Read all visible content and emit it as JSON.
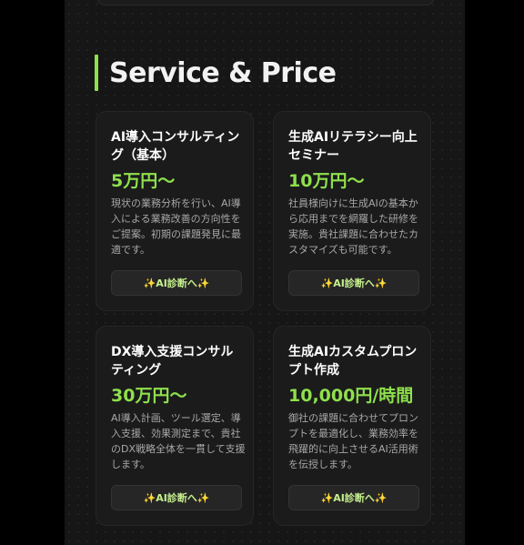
{
  "section": {
    "title": "Service & Price"
  },
  "cards": [
    {
      "title": "AI導入コンサルティング（基本）",
      "price": "5万円〜",
      "description": "現状の業務分析を行い、AI導入による業務改善の方向性をご提案。初期の課題発見に最適です。",
      "button": "✨AI診断へ✨"
    },
    {
      "title": "生成AIリテラシー向上セミナー",
      "price": "10万円〜",
      "description": "社員様向けに生成AIの基本から応用までを網羅した研修を実施。貴社課題に合わせたカスタマイズも可能です。",
      "button": "✨AI診断へ✨"
    },
    {
      "title": "DX導入支援コンサルティング",
      "price": "30万円〜",
      "description": "AI導入計画、ツール選定、導入支援、効果測定まで、貴社のDX戦略全体を一貫して支援します。",
      "button": "✨AI診断へ✨"
    },
    {
      "title": "生成AIカスタムプロンプト作成",
      "price": "10,000円/時間",
      "description": "御社の課題に合わせてプロンプトを最適化し、業務効率を飛躍的に向上させるAI活用術を伝授します。",
      "button": "✨AI診断へ✨"
    }
  ],
  "colors": {
    "accent": "#8ee04c",
    "background": "#161616",
    "card": "#1b1b1b"
  }
}
